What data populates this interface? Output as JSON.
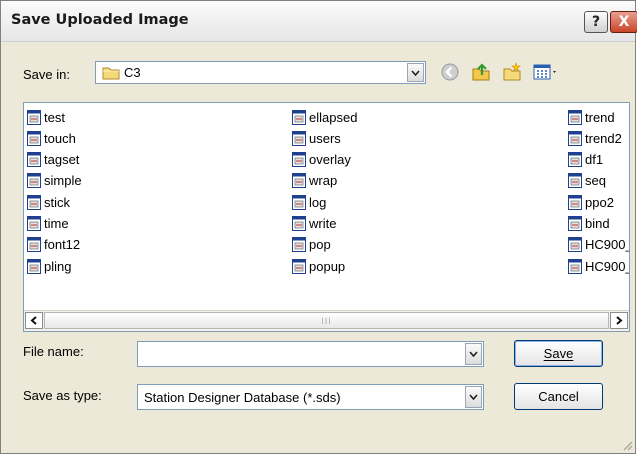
{
  "window": {
    "title": "Save Uploaded Image",
    "help_label": "?",
    "close_label": "X"
  },
  "save_in": {
    "label": "Save in:",
    "value": "C3"
  },
  "toolbar": {
    "icons": [
      "back-icon",
      "up-folder-icon",
      "new-folder-icon",
      "views-menu-icon"
    ]
  },
  "files": {
    "column1": [
      "test",
      "touch",
      "tagset",
      "simple",
      "stick",
      "time",
      "font12",
      "pling"
    ],
    "column2": [
      "ellapsed",
      "users",
      "overlay",
      "wrap",
      "log",
      "write",
      "pop",
      "popup"
    ],
    "column3": [
      "trend",
      "trend2",
      "df1",
      "seq",
      "ppo2",
      "bind",
      "HC900_",
      "HC900_"
    ]
  },
  "scrollbar": {
    "thumb_grip": "III"
  },
  "file_name": {
    "label": "File name:",
    "value": ""
  },
  "save_as_type": {
    "label": "Save as type:",
    "value": "Station Designer Database (*.sds)"
  },
  "buttons": {
    "save": "Save",
    "cancel": "Cancel"
  },
  "colors": {
    "dialog_bg": "#ece9d8",
    "border": "#7f9db9",
    "close_red": "#c9452a"
  }
}
